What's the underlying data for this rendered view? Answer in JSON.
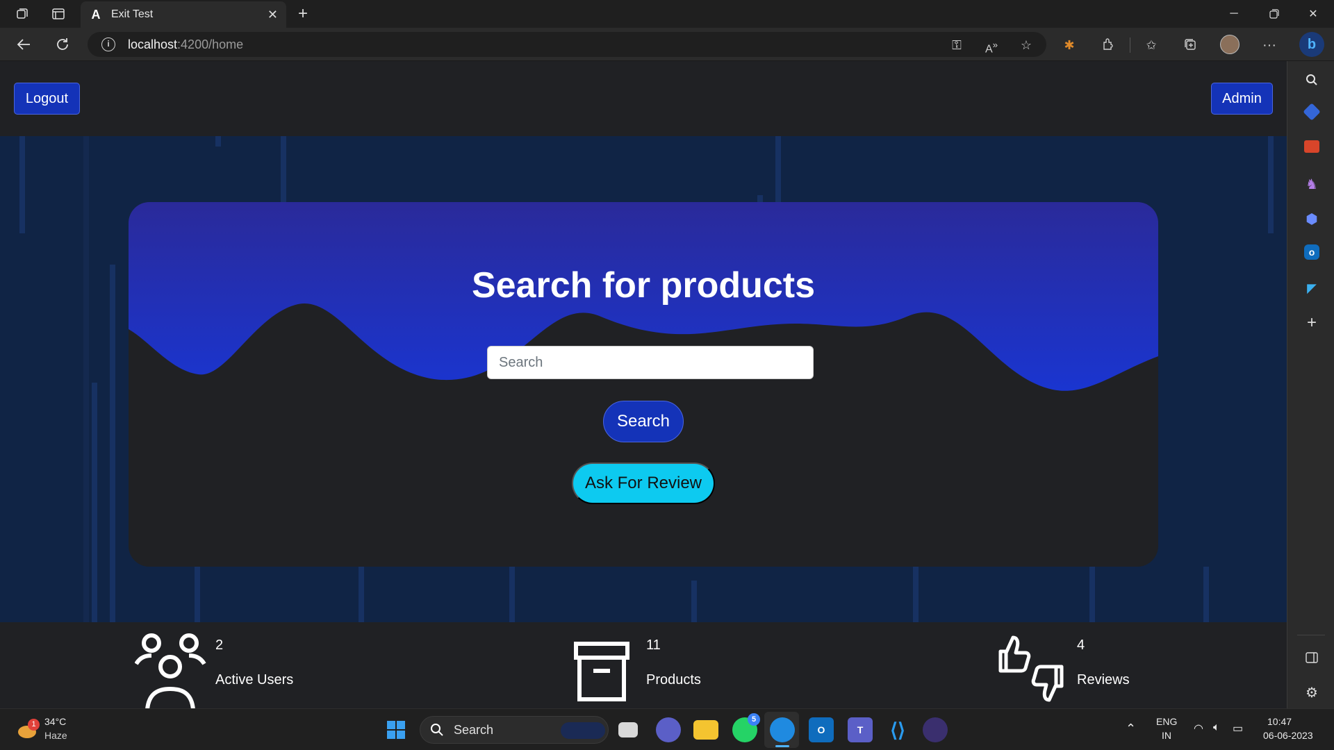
{
  "browser": {
    "tab_title": "Exit Test",
    "tab_favicon_letter": "A",
    "url_host": "localhost",
    "url_rest": ":4200/home"
  },
  "header": {
    "logout_label": "Logout",
    "admin_label": "Admin"
  },
  "hero": {
    "title": "Search for products",
    "search_placeholder": "Search",
    "search_button": "Search",
    "review_button": "Ask For Review"
  },
  "stats": [
    {
      "value": "2",
      "label": "Active Users",
      "icon": "users-icon"
    },
    {
      "value": "11",
      "label": "Products",
      "icon": "archive-box-icon"
    },
    {
      "value": "4",
      "label": "Reviews",
      "icon": "thumbs-up-down-icon"
    }
  ],
  "taskbar": {
    "weather_temp": "34°C",
    "weather_desc": "Haze",
    "weather_badge": "1",
    "search_label": "Search",
    "whatsapp_badge": "5",
    "lang_top": "ENG",
    "lang_bottom": "IN",
    "time": "10:47",
    "date": "06-06-2023"
  },
  "colors": {
    "primary_blue": "#1433b8",
    "cyan": "#0dcaf0",
    "hero_bg": "#102445",
    "dark_bg": "#202124"
  }
}
